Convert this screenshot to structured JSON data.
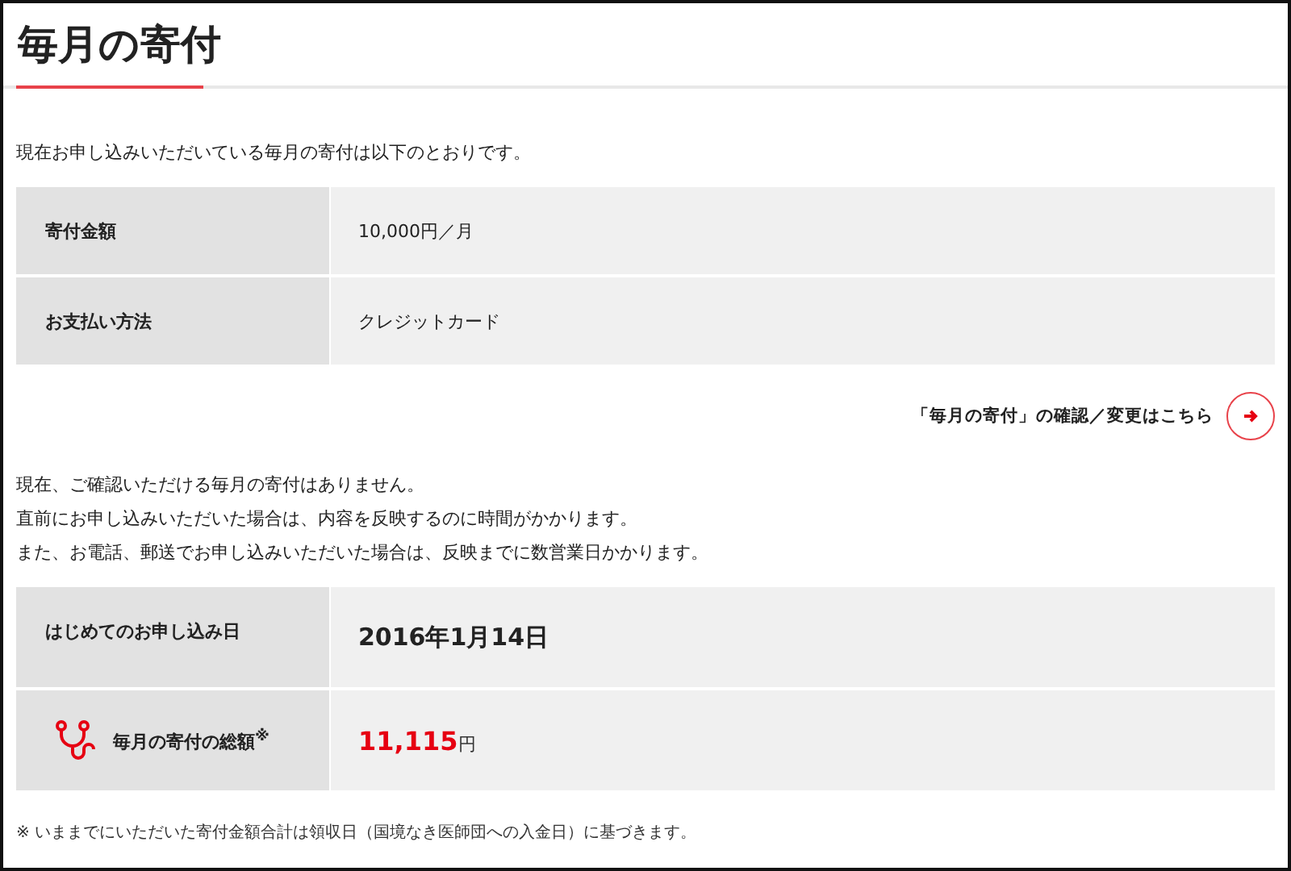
{
  "page_title": "毎月の寄付",
  "intro": "現在お申し込みいただいている毎月の寄付は以下のとおりです。",
  "current_donation": [
    {
      "label": "寄付金額",
      "value": "10,000円／月"
    },
    {
      "label": "お支払い方法",
      "value": "クレジットカード"
    }
  ],
  "change_link": {
    "label": "「毎月の寄付」の確認／変更はこちら"
  },
  "notice_lines": [
    "現在、ご確認いただける毎月の寄付はありません。",
    "直前にお申し込みいただいた場合は、内容を反映するのに時間がかかります。",
    "また、お電話、郵送でお申し込みいただいた場合は、反映までに数営業日かかります。"
  ],
  "summary": [
    {
      "kind": "date",
      "label": "はじめてのお申し込み日",
      "value": "2016年1月14日"
    },
    {
      "kind": "total",
      "label": "毎月の寄付の総額$^{※}$",
      "amount": "11,115",
      "unit": "円"
    }
  ],
  "footnote": "※  いままでにいただいた寄付金額合計は領収日（国境なき医師団への入金日）に基づきます。"
}
